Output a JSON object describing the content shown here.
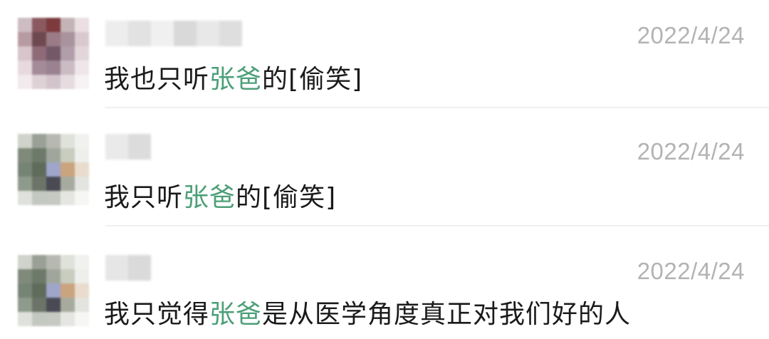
{
  "comments": [
    {
      "date": "2022/4/24",
      "text_before": "我也只听",
      "mention": "张爸",
      "text_after": "的[偷笑]"
    },
    {
      "date": "2022/4/24",
      "text_before": "我只听",
      "mention": "张爸",
      "text_after": "的[偷笑]"
    },
    {
      "date": "2022/4/24",
      "text_before": "我只觉得",
      "mention": "张爸",
      "text_after": "是从医学角度真正对我们好的人"
    }
  ],
  "colors": {
    "mention": "#4c9f78",
    "timestamp": "#b3b3b3",
    "text": "#1a1a1a"
  }
}
